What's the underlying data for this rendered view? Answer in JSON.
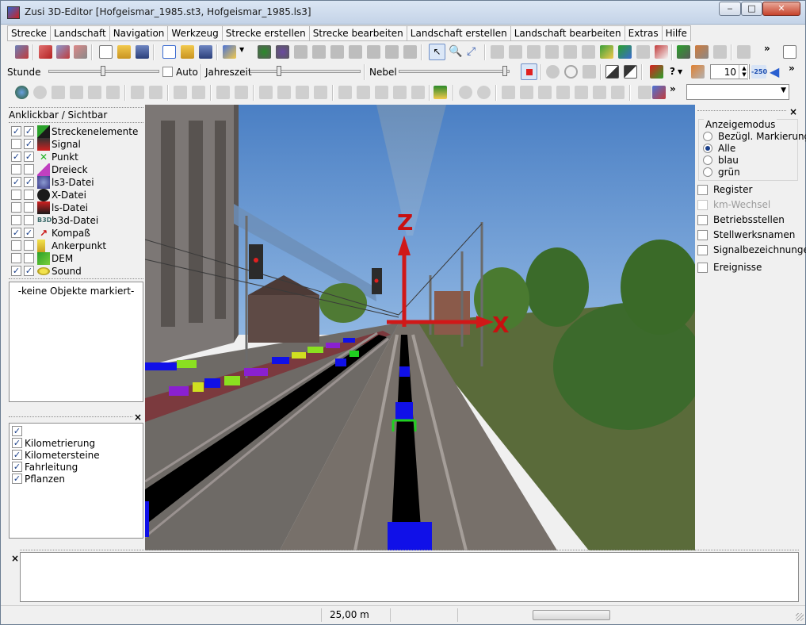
{
  "window": {
    "title": "Zusi 3D-Editor [Hofgeismar_1985.st3, Hofgeismar_1985.ls3]",
    "min_glyph": "‒",
    "max_glyph": "□",
    "close_glyph": "✕"
  },
  "menu": [
    "Strecke",
    "Landschaft",
    "Navigation",
    "Werkzeug",
    "Strecke erstellen",
    "Strecke bearbeiten",
    "Landschaft erstellen",
    "Landschaft bearbeiten",
    "Extras",
    "Hilfe"
  ],
  "toolbar2": {
    "stunde_label": "Stunde",
    "stunde_level": 0.5,
    "auto_label": "Auto",
    "auto_checked": false,
    "jahreszeit_label": "Jahreszeit",
    "jahreszeit_level": 0.25,
    "nebel_label": "Nebel",
    "nebel_level": 1.0,
    "help_glyph": "?",
    "spin_value": "10",
    "minus250_label": "-250",
    "overflow_glyph": "»"
  },
  "layers": {
    "header": "Anklickbar / Sichtbar",
    "items": [
      {
        "label": "Streckenelemente",
        "clickable": true,
        "visible": true,
        "icon": "track-element-icon"
      },
      {
        "label": "Signal",
        "clickable": false,
        "visible": true,
        "icon": "signal-icon"
      },
      {
        "label": "Punkt",
        "clickable": true,
        "visible": true,
        "icon": "point-icon"
      },
      {
        "label": "Dreieck",
        "clickable": false,
        "visible": false,
        "icon": "triangle-icon"
      },
      {
        "label": "ls3-Datei",
        "clickable": true,
        "visible": true,
        "icon": "ls3-file-icon"
      },
      {
        "label": "X-Datei",
        "clickable": false,
        "visible": false,
        "icon": "x-file-icon"
      },
      {
        "label": "ls-Datei",
        "clickable": false,
        "visible": false,
        "icon": "ls-file-icon"
      },
      {
        "label": "b3d-Datei",
        "clickable": false,
        "visible": false,
        "icon": "b3d-file-icon"
      },
      {
        "label": "Kompaß",
        "clickable": true,
        "visible": true,
        "icon": "compass-icon"
      },
      {
        "label": "Ankerpunkt",
        "clickable": false,
        "visible": false,
        "icon": "anchor-point-icon"
      },
      {
        "label": "DEM",
        "clickable": false,
        "visible": false,
        "icon": "dem-icon"
      },
      {
        "label": "Sound",
        "clickable": true,
        "visible": true,
        "icon": "sound-icon"
      }
    ],
    "b3d_icon_text": "B3D"
  },
  "marked": {
    "text": "-keine Objekte markiert-"
  },
  "options": {
    "close_glyph": "×",
    "items": [
      {
        "label": "",
        "checked": true
      },
      {
        "label": "Kilometrierung",
        "checked": true
      },
      {
        "label": "Kilometersteine",
        "checked": true
      },
      {
        "label": "Fahrleitung",
        "checked": true
      },
      {
        "label": "Pflanzen",
        "checked": true
      }
    ]
  },
  "viewport": {
    "axis_z": "Z",
    "axis_x": "X"
  },
  "right_panel": {
    "close_glyph": "×",
    "mode_title": "Anzeigemodus",
    "modes": [
      {
        "label": "Bezügl. Markierung",
        "selected": false
      },
      {
        "label": "Alle",
        "selected": true
      },
      {
        "label": "blau",
        "selected": false
      },
      {
        "label": "grün",
        "selected": false
      }
    ],
    "checks": [
      {
        "label": "Register",
        "checked": false,
        "enabled": true
      },
      {
        "label": "km-Wechsel",
        "checked": false,
        "enabled": false
      },
      {
        "label": "Betriebsstellen",
        "checked": false,
        "enabled": true
      },
      {
        "label": "Stellwerksnamen",
        "checked": false,
        "enabled": true
      },
      {
        "label": "Signalbezeichnunge",
        "checked": false,
        "enabled": true
      },
      {
        "label": "Ereignisse",
        "checked": false,
        "enabled": true
      }
    ]
  },
  "bottom": {
    "close_glyph": "×"
  },
  "status": {
    "distance": "25,00 m"
  }
}
